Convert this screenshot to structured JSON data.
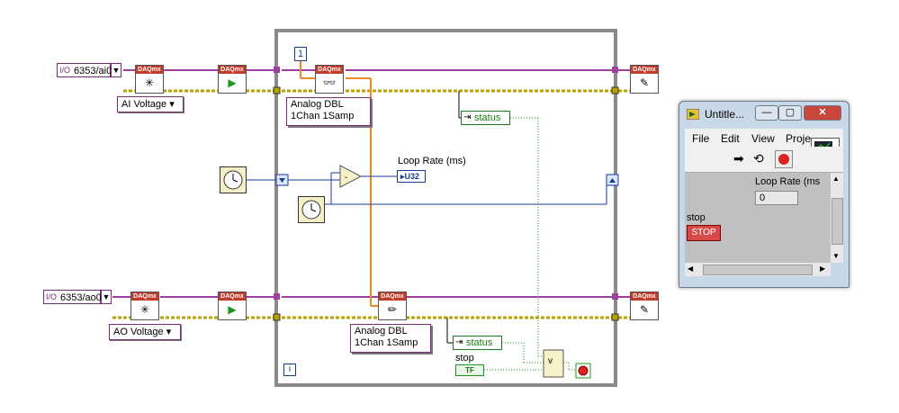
{
  "block_diagram": {
    "ai_channel": "6353/ai0",
    "ao_channel": "6353/ao0",
    "ai_ring": "AI Voltage",
    "ao_ring": "AO Voltage",
    "read_polymorphic": [
      "Analog DBL",
      "1Chan 1Samp"
    ],
    "write_polymorphic": [
      "Analog DBL",
      "1Chan 1Samp"
    ],
    "status_top": "status",
    "status_bottom": "status",
    "loop_rate_label": "Loop Rate (ms)",
    "loop_rate_type": "U32",
    "stop_label": "stop",
    "stop_terminal": "TF",
    "timeout_const": "1",
    "daq_header": "DAQmx",
    "iteration_terminal": "i",
    "compound_or": "v"
  },
  "front_panel": {
    "title": "Untitle...",
    "menu": [
      "File",
      "Edit",
      "View",
      "Proje"
    ],
    "loop_rate_label": "Loop Rate (ms",
    "loop_rate_value": "0",
    "stop_label": "stop",
    "stop_button": "STOP",
    "icon_number": "2"
  },
  "colors": {
    "daqmx_task_wire": "#a040a0",
    "error_wire": "#b8a200",
    "numeric_blue": "#1a3a9a",
    "integer_orange": "#f08a20",
    "boolean_green": "#1a9a1a",
    "loop_frame": "#888888"
  }
}
